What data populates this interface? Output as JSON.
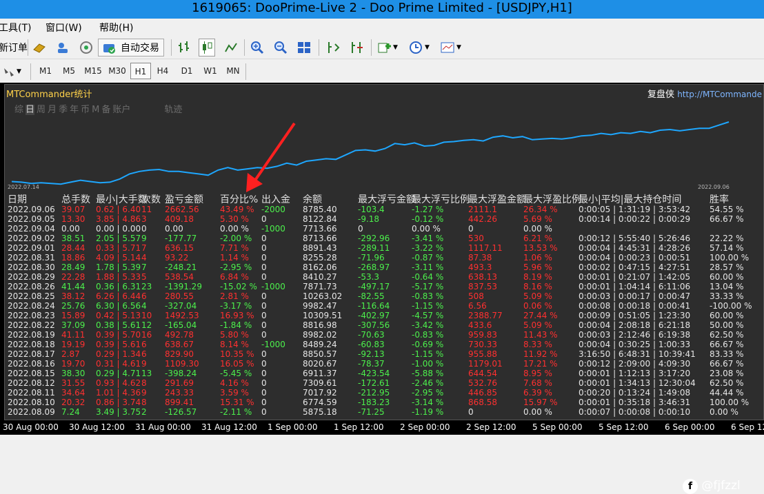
{
  "window": {
    "title": "1619065: DooPrime-Live 2 - Doo Prime Limited - [USDJPY,H1]"
  },
  "menu": [
    "工具(T)",
    "窗口(W)",
    "帮助(H)"
  ],
  "toolbar": {
    "new_order": "新订单",
    "auto_trading": "自动交易"
  },
  "timeframes": [
    "M1",
    "M5",
    "M15",
    "M30",
    "H1",
    "H4",
    "D1",
    "W1",
    "MN"
  ],
  "active_timeframe": "H1",
  "panel": {
    "title": "MTCommander统计",
    "brand": "复盘侠",
    "url": "http://MTCommande",
    "tabs": [
      "综",
      "日",
      "周",
      "月",
      "季",
      "年",
      "币",
      "M",
      "备",
      "账户",
      "轨迹"
    ],
    "selected_tab": "日",
    "date_left": "2022.07.14",
    "date_right": "2022.09.06"
  },
  "equity_curve": [
    0.06,
    0.05,
    0.03,
    0.04,
    0.03,
    0.02,
    0.05,
    0.08,
    0.06,
    0.04,
    0.05,
    0.1,
    0.18,
    0.22,
    0.24,
    0.25,
    0.22,
    0.22,
    0.2,
    0.18,
    0.16,
    0.24,
    0.28,
    0.24,
    0.26,
    0.28,
    0.27,
    0.3,
    0.35,
    0.32,
    0.38,
    0.4,
    0.42,
    0.41,
    0.48,
    0.55,
    0.56,
    0.54,
    0.58,
    0.66,
    0.64,
    0.67,
    0.62,
    0.63,
    0.68,
    0.69,
    0.71,
    0.72,
    0.7,
    0.76,
    0.78,
    0.75,
    0.77,
    0.72,
    0.73,
    0.74,
    0.73,
    0.75,
    0.78,
    0.79,
    0.82,
    0.8,
    0.83,
    0.82,
    0.85,
    0.83,
    0.87,
    0.88,
    0.86,
    0.88,
    0.9,
    0.9,
    0.95,
    1.0
  ],
  "columns": [
    "日期",
    "总手数",
    "最小|大手数",
    "次数",
    "盈亏金额",
    "百分比%",
    "出入金",
    "余额",
    "最大浮亏金额",
    "最大浮亏比例",
    "最大浮盈金额",
    "最大浮盈比例",
    "最小|平均|最大持仓时间",
    "胜率"
  ],
  "rows": [
    [
      "2022.09.06",
      "39.07",
      "0.62 | 6.40",
      "11",
      "2662.56",
      "43.49 %",
      "-2000",
      "8785.40",
      "-103.4",
      "-1.27 %",
      "2111.1",
      "26.34 %",
      "0:00:05 | 1:31:19 | 3:53:42",
      "54.55 %"
    ],
    [
      "2022.09.05",
      "13.30",
      "3.85 | 4.86",
      "3",
      "409.18",
      "5.30 %",
      "0",
      "8122.84",
      "-9.18",
      "-0.12 %",
      "442.26",
      "5.69 %",
      "0:00:14 | 0:00:22 | 0:00:29",
      "66.67 %"
    ],
    [
      "2022.09.04",
      "0.00",
      "0.00 | 0.00",
      "0",
      "0.00",
      "0.00 %",
      "-1000",
      "7713.66",
      "0",
      "0.00 %",
      "0",
      "0.00 %",
      "",
      ""
    ],
    [
      "2022.09.02",
      "38.51",
      "2.05 | 5.57",
      "9",
      "-177.77",
      "-2.00 %",
      "0",
      "8713.66",
      "-292.96",
      "-3.41 %",
      "530",
      "6.21 %",
      "0:00:12 | 5:55:40 | 5:26:46",
      "22.22 %"
    ],
    [
      "2022.09.01",
      "28.44",
      "0.33 | 5.71",
      "7",
      "636.15",
      "7.71 %",
      "0",
      "8891.43",
      "-289.11",
      "-3.22 %",
      "1117.11",
      "13.53 %",
      "0:00:04 | 4:45:31 | 4:28:26",
      "57.14 %"
    ],
    [
      "2022.08.31",
      "18.86",
      "4.09 | 5.14",
      "4",
      "93.22",
      "1.14 %",
      "0",
      "8255.28",
      "-71.96",
      "-0.87 %",
      "87.38",
      "1.06 %",
      "0:00:04 | 0:00:23 | 0:00:51",
      "100.00 %"
    ],
    [
      "2022.08.30",
      "28.49",
      "1.78 | 5.39",
      "7",
      "-248.21",
      "-2.95 %",
      "0",
      "8162.06",
      "-268.97",
      "-3.11 %",
      "493.3",
      "5.96 %",
      "0:00:02 | 0:47:15 | 4:27:51",
      "28.57 %"
    ],
    [
      "2022.08.29",
      "22.28",
      "1.88 | 5.33",
      "5",
      "538.54",
      "6.84 %",
      "0",
      "8410.27",
      "-53.3",
      "-0.64 %",
      "638.13",
      "8.19 %",
      "0:00:01 | 0:21:07 | 1:42:05",
      "60.00 %"
    ],
    [
      "2022.08.26",
      "41.44",
      "0.36 | 6.31",
      "23",
      "-1391.29",
      "-15.02 %",
      "-1000",
      "7871.73",
      "-497.17",
      "-5.17 %",
      "837.53",
      "8.16 %",
      "0:00:01 | 1:04:14 | 6:11:06",
      "13.04 %"
    ],
    [
      "2022.08.25",
      "38.12",
      "6.26 | 6.44",
      "6",
      "280.55",
      "2.81 %",
      "0",
      "10263.02",
      "-82.55",
      "-0.83 %",
      "508",
      "5.09 %",
      "0:00:03 | 0:00:17 | 0:00:47",
      "33.33 %"
    ],
    [
      "2022.08.24",
      "25.76",
      "6.30 | 6.56",
      "4",
      "-327.04",
      "-3.17 %",
      "0",
      "9982.47",
      "-116.64",
      "-1.15 %",
      "6.56",
      "0.06 %",
      "0:00:08 | 0:00:18 | 0:00:41",
      "-100.00 %"
    ],
    [
      "2022.08.23",
      "15.89",
      "0.42 | 5.13",
      "10",
      "1492.53",
      "16.93 %",
      "0",
      "10309.51",
      "-402.97",
      "-4.57 %",
      "2388.77",
      "27.44 %",
      "0:00:09 | 0:51:05 | 1:23:30",
      "60.00 %"
    ],
    [
      "2022.08.22",
      "37.09",
      "0.38 | 5.61",
      "12",
      "-165.04",
      "-1.84 %",
      "0",
      "8816.98",
      "-307.56",
      "-3.42 %",
      "433.6",
      "5.09 %",
      "0:00:04 | 2:08:18 | 6:21:18",
      "50.00 %"
    ],
    [
      "2022.08.19",
      "41.11",
      "0.39 | 5.70",
      "16",
      "492.78",
      "5.80 %",
      "0",
      "8982.02",
      "-70.63",
      "-0.83 %",
      "959.83",
      "11.43 %",
      "0:00:03 | 2:12:46 | 6:19:38",
      "62.50 %"
    ],
    [
      "2022.08.18",
      "19.19",
      "0.39 | 5.61",
      "6",
      "638.67",
      "8.14 %",
      "-1000",
      "8489.24",
      "-60.83",
      "-0.69 %",
      "730.33",
      "8.33 %",
      "0:00:04 | 0:30:25 | 1:00:33",
      "66.67 %"
    ],
    [
      "2022.08.17",
      "2.87",
      "0.29 | 1.34",
      "6",
      "829.90",
      "10.35 %",
      "0",
      "8850.57",
      "-92.13",
      "-1.15 %",
      "955.88",
      "11.92 %",
      "3:16:50 | 6:48:31 | 10:39:41",
      "83.33 %"
    ],
    [
      "2022.08.16",
      "19.70",
      "0.31 | 4.61",
      "9",
      "1109.30",
      "16.05 %",
      "0",
      "8020.67",
      "-78.37",
      "-1.00 %",
      "1179.01",
      "17.21 %",
      "0:00:12 | 2:09:00 | 4:09:30",
      "66.67 %"
    ],
    [
      "2022.08.15",
      "38.30",
      "0.29 | 4.71",
      "13",
      "-398.24",
      "-5.45 %",
      "0",
      "6911.37",
      "-423.54",
      "-5.88 %",
      "644.54",
      "8.95 %",
      "0:00:01 | 1:12:13 | 3:17:20",
      "23.08 %"
    ],
    [
      "2022.08.12",
      "31.55",
      "0.93 | 4.62",
      "8",
      "291.69",
      "4.16 %",
      "0",
      "7309.61",
      "-172.61",
      "-2.46 %",
      "532.76",
      "7.68 %",
      "0:00:01 | 1:34:13 | 12:30:04",
      "62.50 %"
    ],
    [
      "2022.08.11",
      "34.64",
      "1.01 | 4.36",
      "9",
      "243.33",
      "3.59 %",
      "0",
      "7017.92",
      "-212.95",
      "-2.95 %",
      "446.85",
      "6.39 %",
      "0:00:20 | 0:13:24 | 1:49:08",
      "44.44 %"
    ],
    [
      "2022.08.10",
      "20.32",
      "0.86 | 3.74",
      "8",
      "899.41",
      "15.31 %",
      "0",
      "6774.59",
      "-183.23",
      "-3.14 %",
      "868.58",
      "15.97 %",
      "0:00:01 | 0:35:18 | 3:46:31",
      "100.00 %"
    ],
    [
      "2022.08.09",
      "7.24",
      "3.49 | 3.75",
      "2",
      "-126.57",
      "-2.11 %",
      "0",
      "5875.18",
      "-71.25",
      "-1.19 %",
      "0",
      "0.00 %",
      "0:00:07 | 0:00:08 | 0:00:10",
      "0.00 %"
    ]
  ],
  "xaxis": [
    "30 Aug 00:00",
    "30 Aug 12:00",
    "31 Aug 00:00",
    "31 Aug 12:00",
    "1 Sep 00:00",
    "1 Sep 12:00",
    "2 Sep 00:00",
    "2 Sep 12:00",
    "5 Sep 00:00",
    "5 Sep 12:00",
    "6 Sep 00:00",
    "6 Sep 12"
  ],
  "watermark": "@fjfzzl",
  "colors": {
    "accent": "#1e8fe6",
    "curve": "#1ea7ff",
    "positive": "#4cf04c",
    "negative": "#ff3030"
  }
}
